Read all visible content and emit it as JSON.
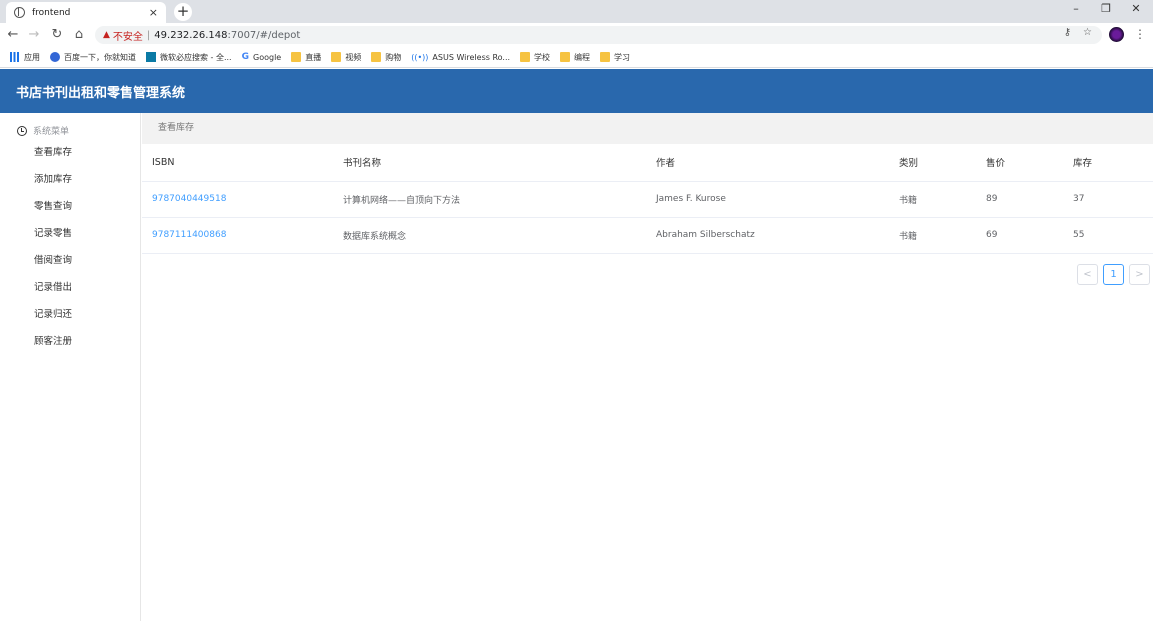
{
  "browser": {
    "tab_title": "frontend",
    "tab_close": "×",
    "new_tab": "+",
    "url_warning_icon": "▲",
    "url_insecure": "不安全",
    "url_sep": "|",
    "url_host": "49.232.26.148",
    "url_path": ":7007/#/depot",
    "win_minimize": "–",
    "win_restore": "❐",
    "win_close": "✕",
    "back": "←",
    "forward": "→",
    "reload": "↻",
    "home": "⌂",
    "key_icon": "⚷",
    "star_icon": "☆",
    "menu_icon": "⋮",
    "bookmarks": [
      {
        "label": "应用",
        "icon": "apps"
      },
      {
        "label": "百度一下，你就知道",
        "icon": "paw"
      },
      {
        "label": "微软必应搜索 - 全...",
        "icon": "bing"
      },
      {
        "label": "Google",
        "icon": "g"
      },
      {
        "label": "直播",
        "icon": "folder"
      },
      {
        "label": "视频",
        "icon": "folder"
      },
      {
        "label": "购物",
        "icon": "folder"
      },
      {
        "label": "ASUS Wireless Ro...",
        "icon": "wifi"
      },
      {
        "label": "学校",
        "icon": "folder"
      },
      {
        "label": "编程",
        "icon": "folder"
      },
      {
        "label": "学习",
        "icon": "folder"
      }
    ]
  },
  "app": {
    "title": "书店书刊出租和零售管理系统",
    "header_color": "#2968ad"
  },
  "sidebar": {
    "group_label": "系统菜单",
    "items": [
      {
        "label": "查看库存"
      },
      {
        "label": "添加库存"
      },
      {
        "label": "零售查询"
      },
      {
        "label": "记录零售"
      },
      {
        "label": "借阅查询"
      },
      {
        "label": "记录借出"
      },
      {
        "label": "记录归还"
      },
      {
        "label": "顾客注册"
      }
    ]
  },
  "main": {
    "breadcrumb": "查看库存",
    "columns": [
      "ISBN",
      "书刊名称",
      "作者",
      "类别",
      "售价",
      "库存"
    ],
    "rows": [
      [
        "9787040449518",
        "计算机网络——自顶向下方法",
        "James F. Kurose",
        "书籍",
        "89",
        "37"
      ],
      [
        "9787111400868",
        "数据库系统概念",
        "Abraham Silberschatz",
        "书籍",
        "69",
        "55"
      ]
    ],
    "pagination": {
      "prev": "<",
      "current": "1",
      "next": ">"
    }
  }
}
